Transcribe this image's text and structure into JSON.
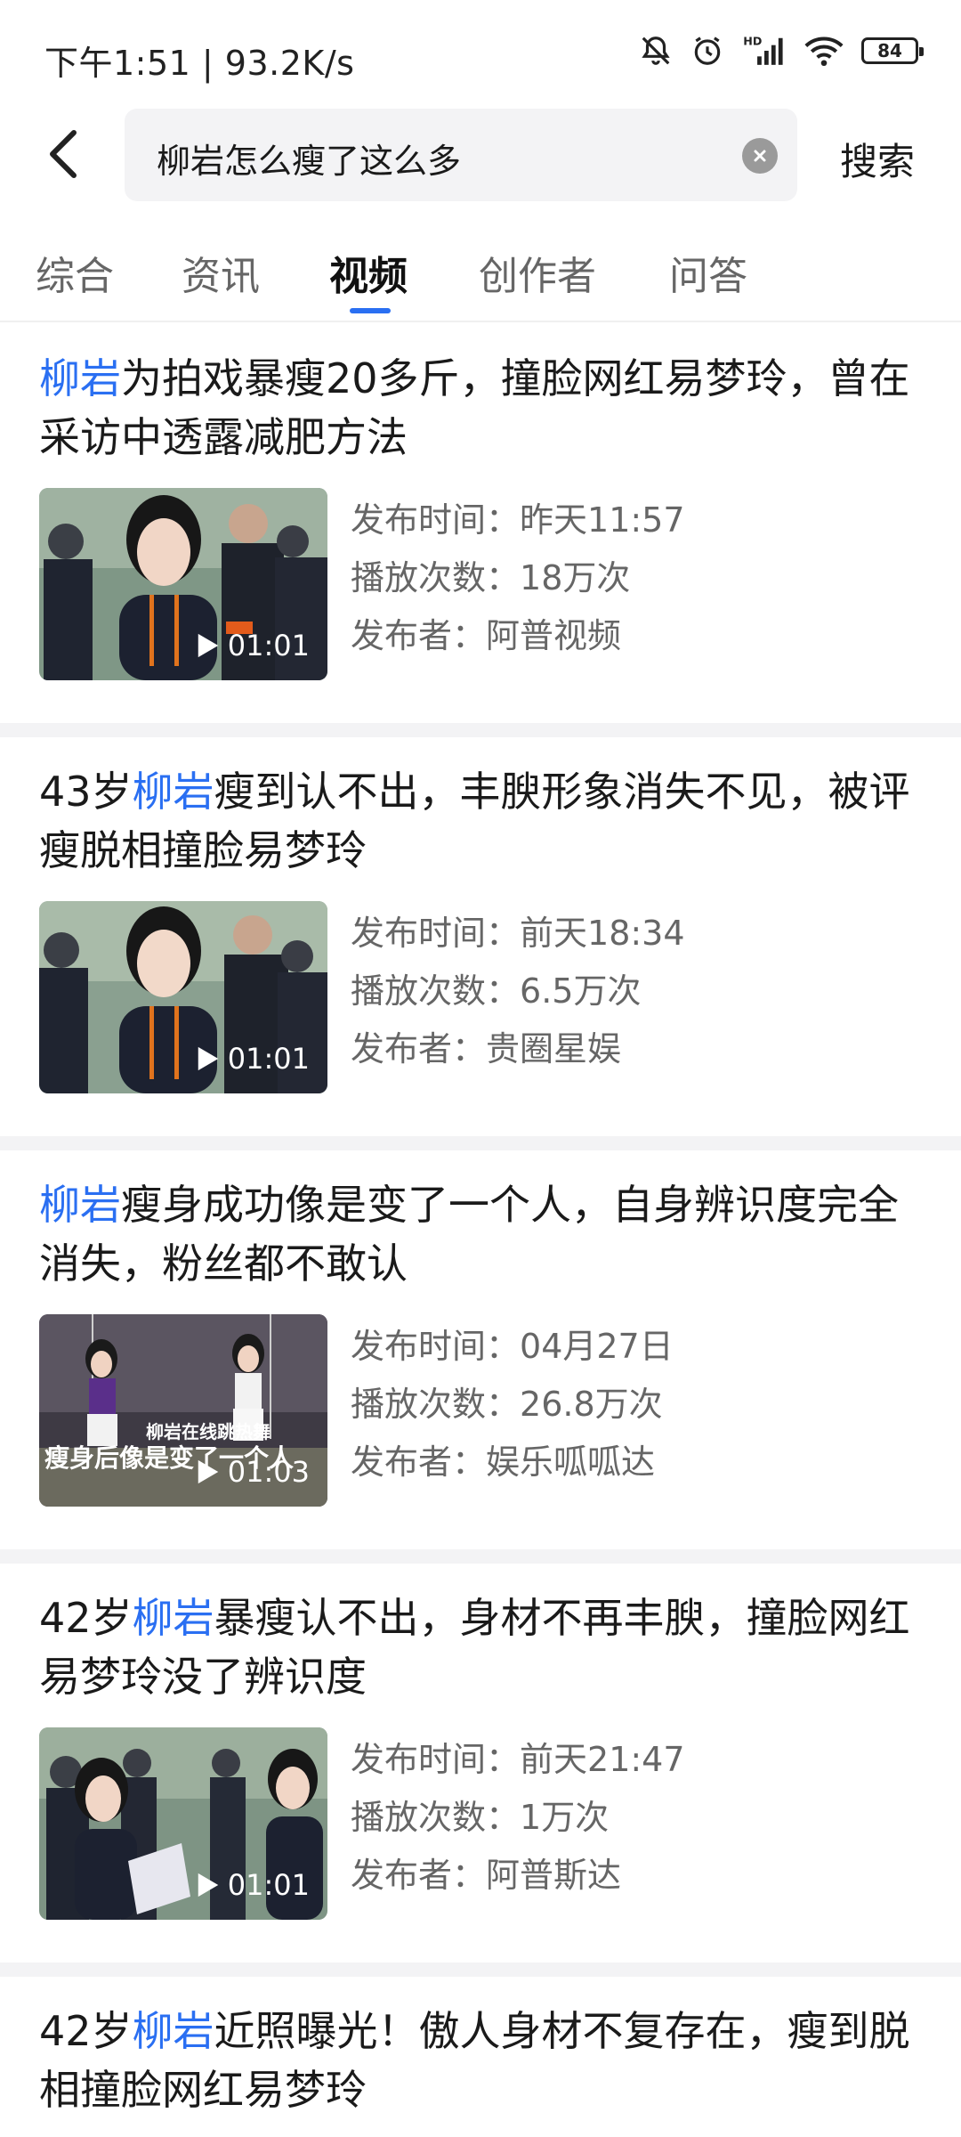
{
  "status": {
    "time_speed": "下午1:51 | 93.2K/s",
    "battery": "84",
    "hd_label": "HD"
  },
  "search": {
    "query": "柳岩怎么瘦了这么多",
    "search_label": "搜索"
  },
  "tabs": [
    {
      "label": "综合",
      "active": false
    },
    {
      "label": "资讯",
      "active": false
    },
    {
      "label": "视频",
      "active": true
    },
    {
      "label": "创作者",
      "active": false
    },
    {
      "label": "问答",
      "active": false
    }
  ],
  "meta_labels": {
    "time": "发布时间：",
    "plays": "播放次数：",
    "author": "发布者："
  },
  "results": [
    {
      "title_pre": "",
      "title_hl": "柳岩",
      "title_post": "为拍戏暴瘦20多斤，撞脸网红易梦玲，曾在采访中透露减肥方法",
      "duration": "01:01",
      "time": "昨天11:57",
      "plays": "18万次",
      "author": "阿普视频"
    },
    {
      "title_pre": "43岁",
      "title_hl": "柳岩",
      "title_post": "瘦到认不出，丰腴形象消失不见，被评瘦脱相撞脸易梦玲",
      "duration": "01:01",
      "time": "前天18:34",
      "plays": "6.5万次",
      "author": "贵圈星娱"
    },
    {
      "title_pre": "",
      "title_hl": "柳岩",
      "title_post": "瘦身成功像是变了一个人，自身辨识度完全消失，粉丝都不敢认",
      "duration": "01:03",
      "time": "04月27日",
      "plays": "26.8万次",
      "author": "娱乐呱呱达",
      "caption_a": "柳岩在线跳热舞",
      "caption_b": "瘦身后像是变了一个人"
    },
    {
      "title_pre": "42岁",
      "title_hl": "柳岩",
      "title_post": "暴瘦认不出，身材不再丰腴，撞脸网红易梦玲没了辨识度",
      "duration": "01:01",
      "time": "前天21:47",
      "plays": "1万次",
      "author": "阿普斯达"
    },
    {
      "title_pre": "42岁",
      "title_hl": "柳岩",
      "title_post": "近照曝光！傲人身材不复存在，瘦到脱相撞脸网红易梦玲"
    }
  ],
  "colors": {
    "accent": "#2a6ff2",
    "separator": "#f3f3f5",
    "meta_text": "#666666"
  }
}
